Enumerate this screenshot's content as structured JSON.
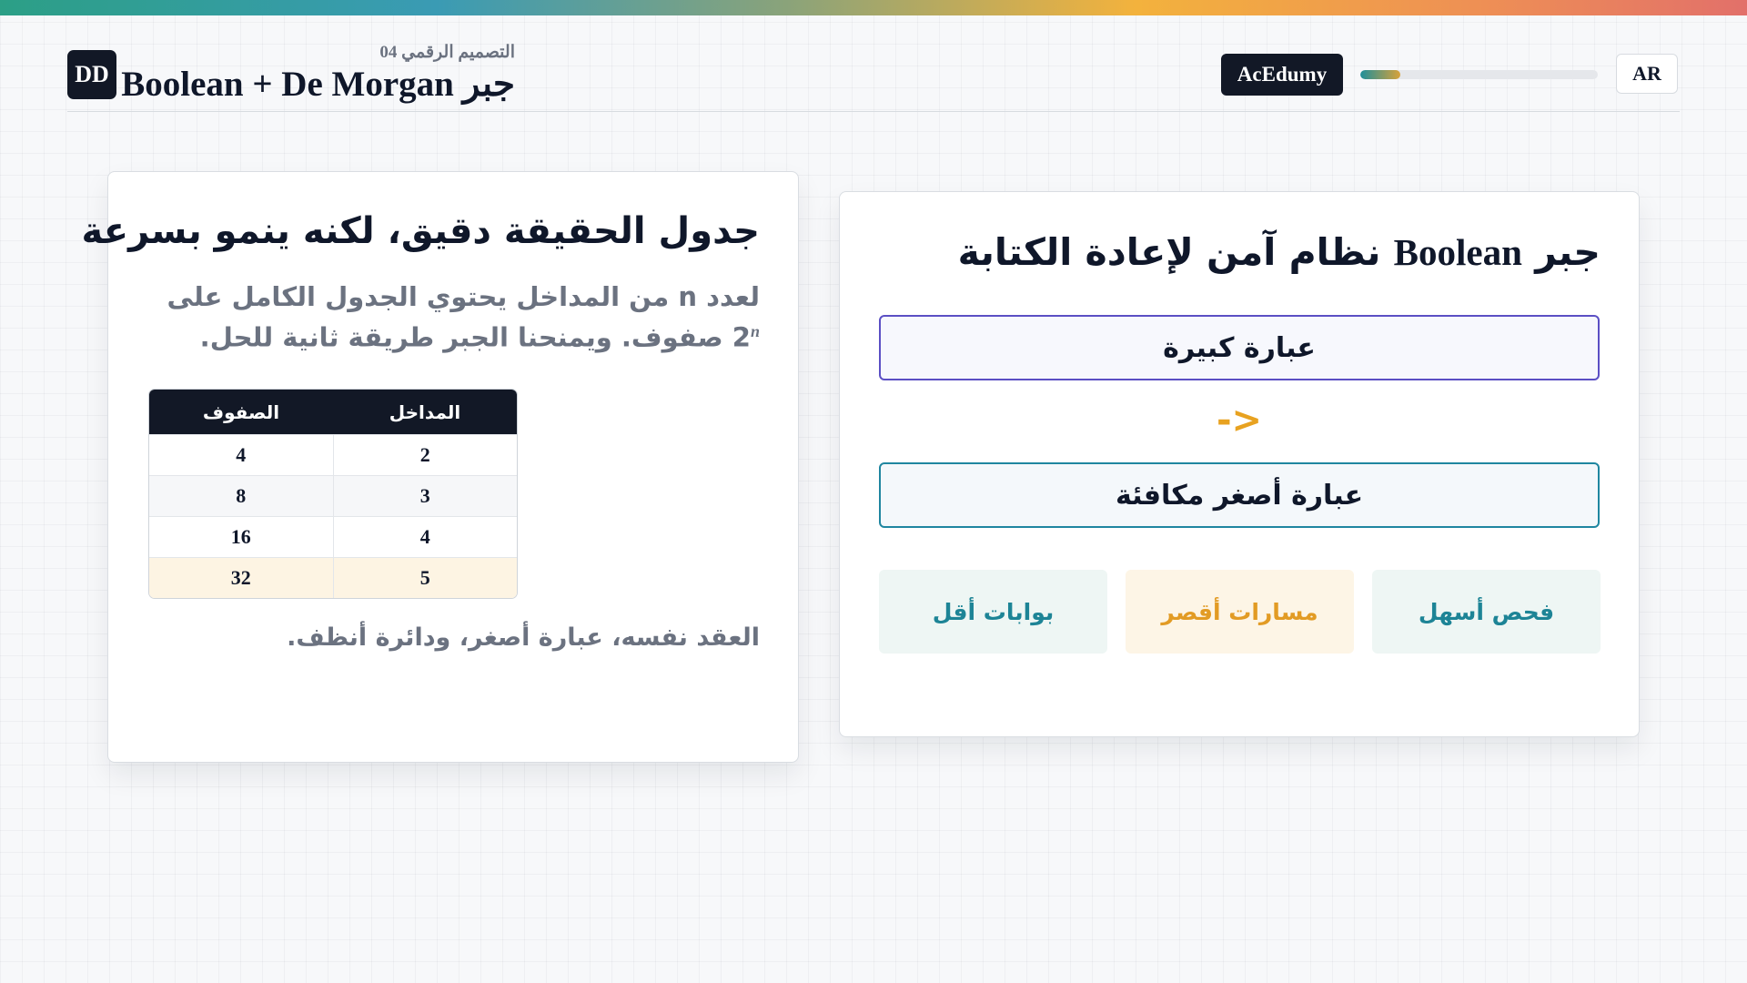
{
  "header": {
    "logo": "DD",
    "subtitle": "التصميم الرقمي 04",
    "title": "جبر Boolean + De Morgan",
    "brand": "AcEdumy",
    "progress_fraction": 0.17,
    "language": "AR"
  },
  "left_card": {
    "heading": "جدول الحقيقة دقيق، لكنه ينمو بسرعة",
    "desc_before_exp": "لعدد n من المداخل يحتوي الجدول الكامل على 2",
    "desc_exp": "n",
    "desc_after_exp": " صفوف. ويمنحنا الجبر طريقة ثانية للحل.",
    "table": {
      "col_rows": "الصفوف",
      "col_inputs": "المداخل",
      "rows": [
        {
          "rows": "4",
          "inputs": "2"
        },
        {
          "rows": "8",
          "inputs": "3"
        },
        {
          "rows": "16",
          "inputs": "4"
        },
        {
          "rows": "32",
          "inputs": "5"
        }
      ]
    },
    "footer": "العقد نفسه، عبارة أصغر، ودائرة أنظف."
  },
  "right_card": {
    "heading_arabic_1": "جبر ",
    "heading_latin": "Boolean",
    "heading_arabic_2": " نظام آمن لإعادة الكتابة",
    "big_expression": "عبارة كبيرة",
    "arrow": "->",
    "small_expression": "عبارة أصغر مكافئة",
    "benefits": [
      "فحص أسهل",
      "مسارات أقصر",
      "بوابات أقل"
    ]
  },
  "colors": {
    "accent_purple": "#5b4fc4",
    "accent_teal": "#1d8496",
    "accent_orange": "#e29b24",
    "dark": "#121826"
  }
}
